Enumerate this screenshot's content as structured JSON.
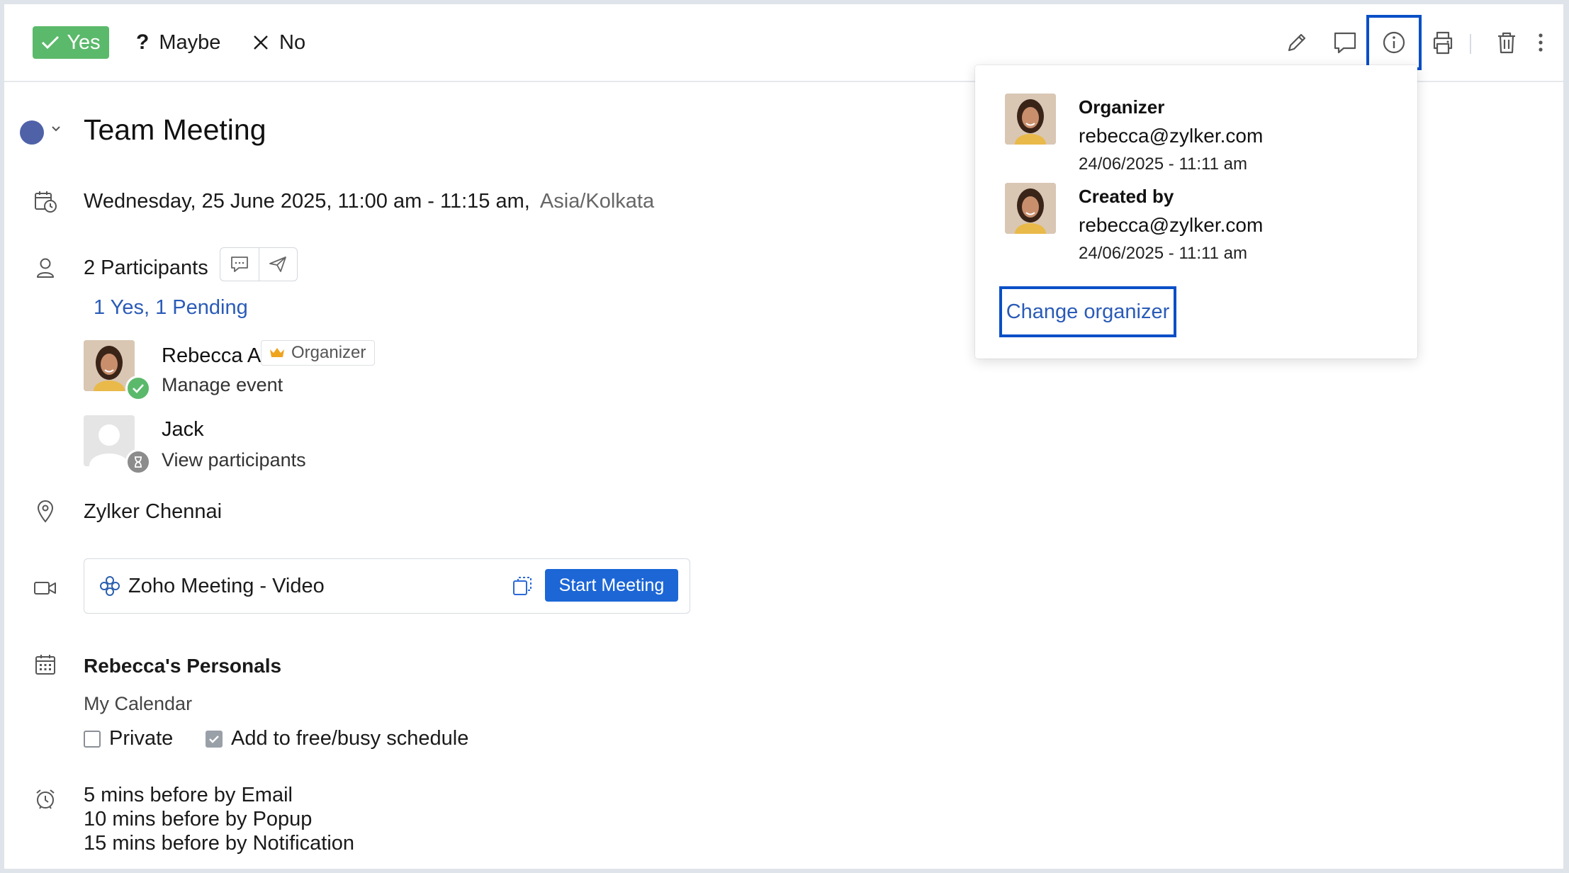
{
  "toolbar": {
    "rsvp": {
      "yes": "Yes",
      "maybe": "Maybe",
      "no": "No",
      "maybe_glyph": "?",
      "no_glyph": "✕"
    },
    "icons": [
      "edit-icon",
      "comment-icon",
      "info-icon",
      "print-icon",
      "delete-icon",
      "more-icon"
    ],
    "active_icon": "info-icon"
  },
  "event": {
    "title": "Team Meeting",
    "date": "Wednesday, 25 June 2025,",
    "time": "11:00 am  - 11:15 am,",
    "timezone": "Asia/Kolkata",
    "color": "#4f62a8"
  },
  "participants": {
    "count_label": "2 Participants",
    "summary": "1 Yes, 1 Pending",
    "list": [
      {
        "name": "Rebecca A",
        "badge": "Organizer",
        "sub": "Manage event",
        "status": "accepted"
      },
      {
        "name": "Jack",
        "sub": "View participants",
        "status": "pending"
      }
    ]
  },
  "location": "Zylker Chennai",
  "meeting": {
    "label": "Zoho Meeting - Video",
    "start_button": "Start Meeting"
  },
  "calendar": {
    "owner": "Rebecca's Personals",
    "name": "My Calendar",
    "private_label": "Private",
    "private_checked": false,
    "freebusy_label": "Add to free/busy schedule",
    "freebusy_checked": true
  },
  "reminders": [
    "5 mins before by Email",
    "10 mins before by Popup",
    "15 mins before by Notification"
  ],
  "info_popover": {
    "organizer_label": "Organizer",
    "organizer_email": "rebecca@zylker.com",
    "organizer_time": "24/06/2025 - 11:11 am",
    "created_label": "Created by",
    "created_email": "rebecca@zylker.com",
    "created_time": "24/06/2025 - 11:11 am",
    "change_button": "Change organizer"
  },
  "colors": {
    "accent": "#1c66d6",
    "yes_green": "#5bb96b",
    "link_blue": "#2a5bb8",
    "highlight": "#0a4fc7"
  }
}
